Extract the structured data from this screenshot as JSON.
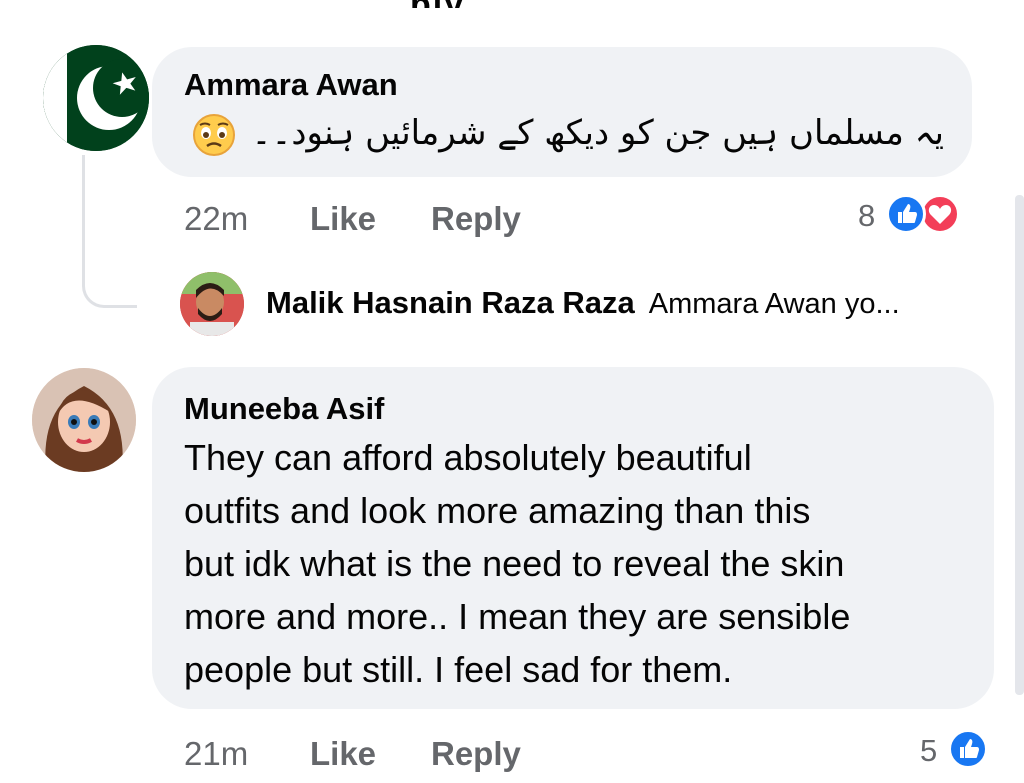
{
  "comments": [
    {
      "author": "Ammara Awan",
      "text": "یہ مسلماں ہیں جن کو دیکھ کے شرمائیں ہنود۔۔",
      "emoji": "😩",
      "time": "22m",
      "like_label": "Like",
      "reply_label": "Reply",
      "reaction_count": "8",
      "reactions": [
        "like-icon",
        "love-icon"
      ],
      "avatar": "pakistan-flag-icon"
    },
    {
      "author": "Muneeba Asif",
      "text_lines": [
        "They can afford absolutely beautiful",
        "outfits and look more amazing than this",
        "but idk what is the need to reveal the skin",
        "more and more.. I mean they are sensible",
        "people but still. I feel sad for them."
      ],
      "time": "21m",
      "like_label": "Like",
      "reply_label": "Reply",
      "reaction_count": "5",
      "reactions": [
        "like-icon"
      ],
      "avatar": "cartoon-girl-avatar"
    }
  ],
  "reply": {
    "author": "Malik Hasnain Raza Raza",
    "preview": "Ammara Awan yo..."
  },
  "colors": {
    "bubble": "#f0f2f5",
    "meta": "#65676b",
    "like_blue": "#1877f2",
    "love_red": "#f33e58",
    "flag_green": "#01411c"
  }
}
